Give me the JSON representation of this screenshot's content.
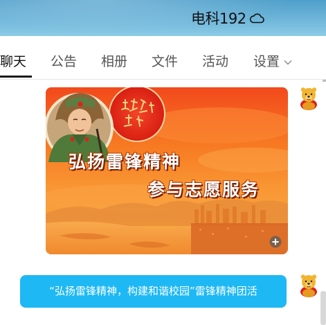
{
  "header": {
    "group_name": "电科192",
    "status_icon": "cloud-icon"
  },
  "tabs": [
    {
      "label": "聊天",
      "active": true
    },
    {
      "label": "公告",
      "active": false
    },
    {
      "label": "相册",
      "active": false
    },
    {
      "label": "文件",
      "active": false
    },
    {
      "label": "活动",
      "active": false
    },
    {
      "label": "设置",
      "active": false,
      "has_dropdown": true
    }
  ],
  "messages": [
    {
      "type": "image",
      "sender_avatar": "winnie-pooh-avatar",
      "image_text": [
        "弘扬雷锋精神",
        "参与志愿服务"
      ],
      "zoom_icon": "zoom-in-icon"
    },
    {
      "type": "text",
      "sender_avatar": "winnie-pooh-avatar",
      "text": "“弘扬雷锋精神，构建和谐校园”雷锋精神团活"
    }
  ],
  "colors": {
    "bubble": "#1eb8f5",
    "titlebar": "#6fb6da",
    "tab_underline": "#1a1a1a"
  }
}
